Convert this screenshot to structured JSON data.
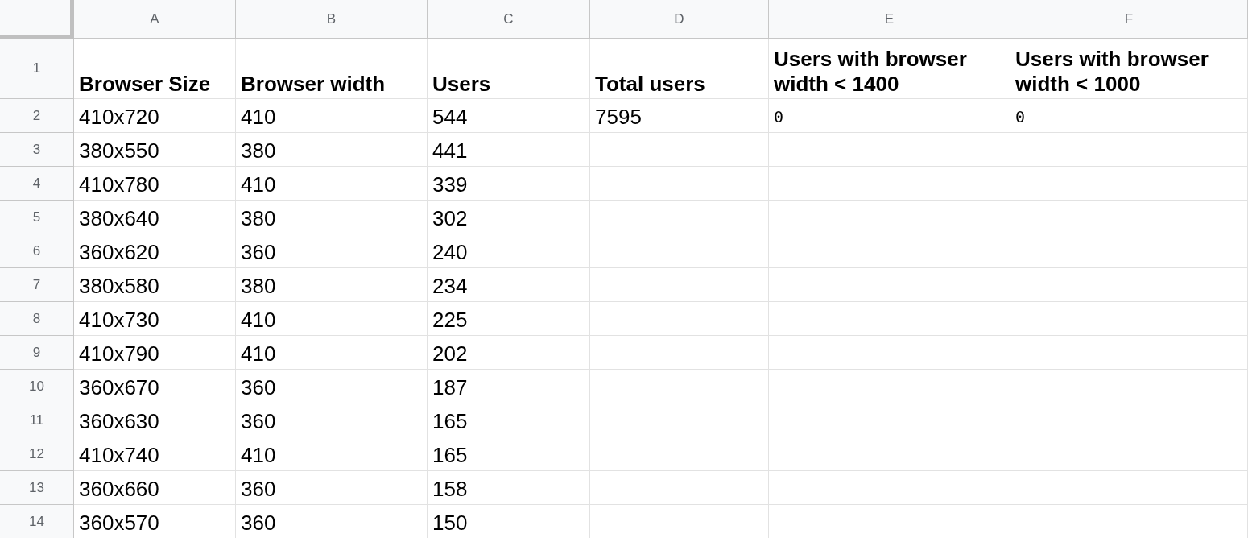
{
  "columns": [
    "A",
    "B",
    "C",
    "D",
    "E",
    "F"
  ],
  "rows": [
    {
      "number": "1",
      "kind": "header",
      "cells": [
        "Browser Size",
        "Browser width",
        "Users",
        "Total users",
        "Users with browser width < 1400",
        "Users with browser width < 1000"
      ]
    },
    {
      "number": "2",
      "cells": [
        "410x720",
        "410",
        "544",
        "7595",
        {
          "text": "0",
          "kind": "formula"
        },
        {
          "text": "0",
          "kind": "formula"
        }
      ]
    },
    {
      "number": "3",
      "cells": [
        "380x550",
        "380",
        "441"
      ]
    },
    {
      "number": "4",
      "cells": [
        "410x780",
        "410",
        "339"
      ]
    },
    {
      "number": "5",
      "cells": [
        "380x640",
        "380",
        "302"
      ]
    },
    {
      "number": "6",
      "cells": [
        "360x620",
        "360",
        "240"
      ]
    },
    {
      "number": "7",
      "cells": [
        "380x580",
        "380",
        "234"
      ]
    },
    {
      "number": "8",
      "cells": [
        "410x730",
        "410",
        "225"
      ]
    },
    {
      "number": "9",
      "cells": [
        "410x790",
        "410",
        "202"
      ]
    },
    {
      "number": "10",
      "cells": [
        "360x670",
        "360",
        "187"
      ]
    },
    {
      "number": "11",
      "cells": [
        "360x630",
        "360",
        "165"
      ]
    },
    {
      "number": "12",
      "cells": [
        "410x740",
        "410",
        "165"
      ]
    },
    {
      "number": "13",
      "cells": [
        "360x660",
        "360",
        "158"
      ]
    },
    {
      "number": "14",
      "cells": [
        "360x570",
        "360",
        "150"
      ]
    }
  ]
}
